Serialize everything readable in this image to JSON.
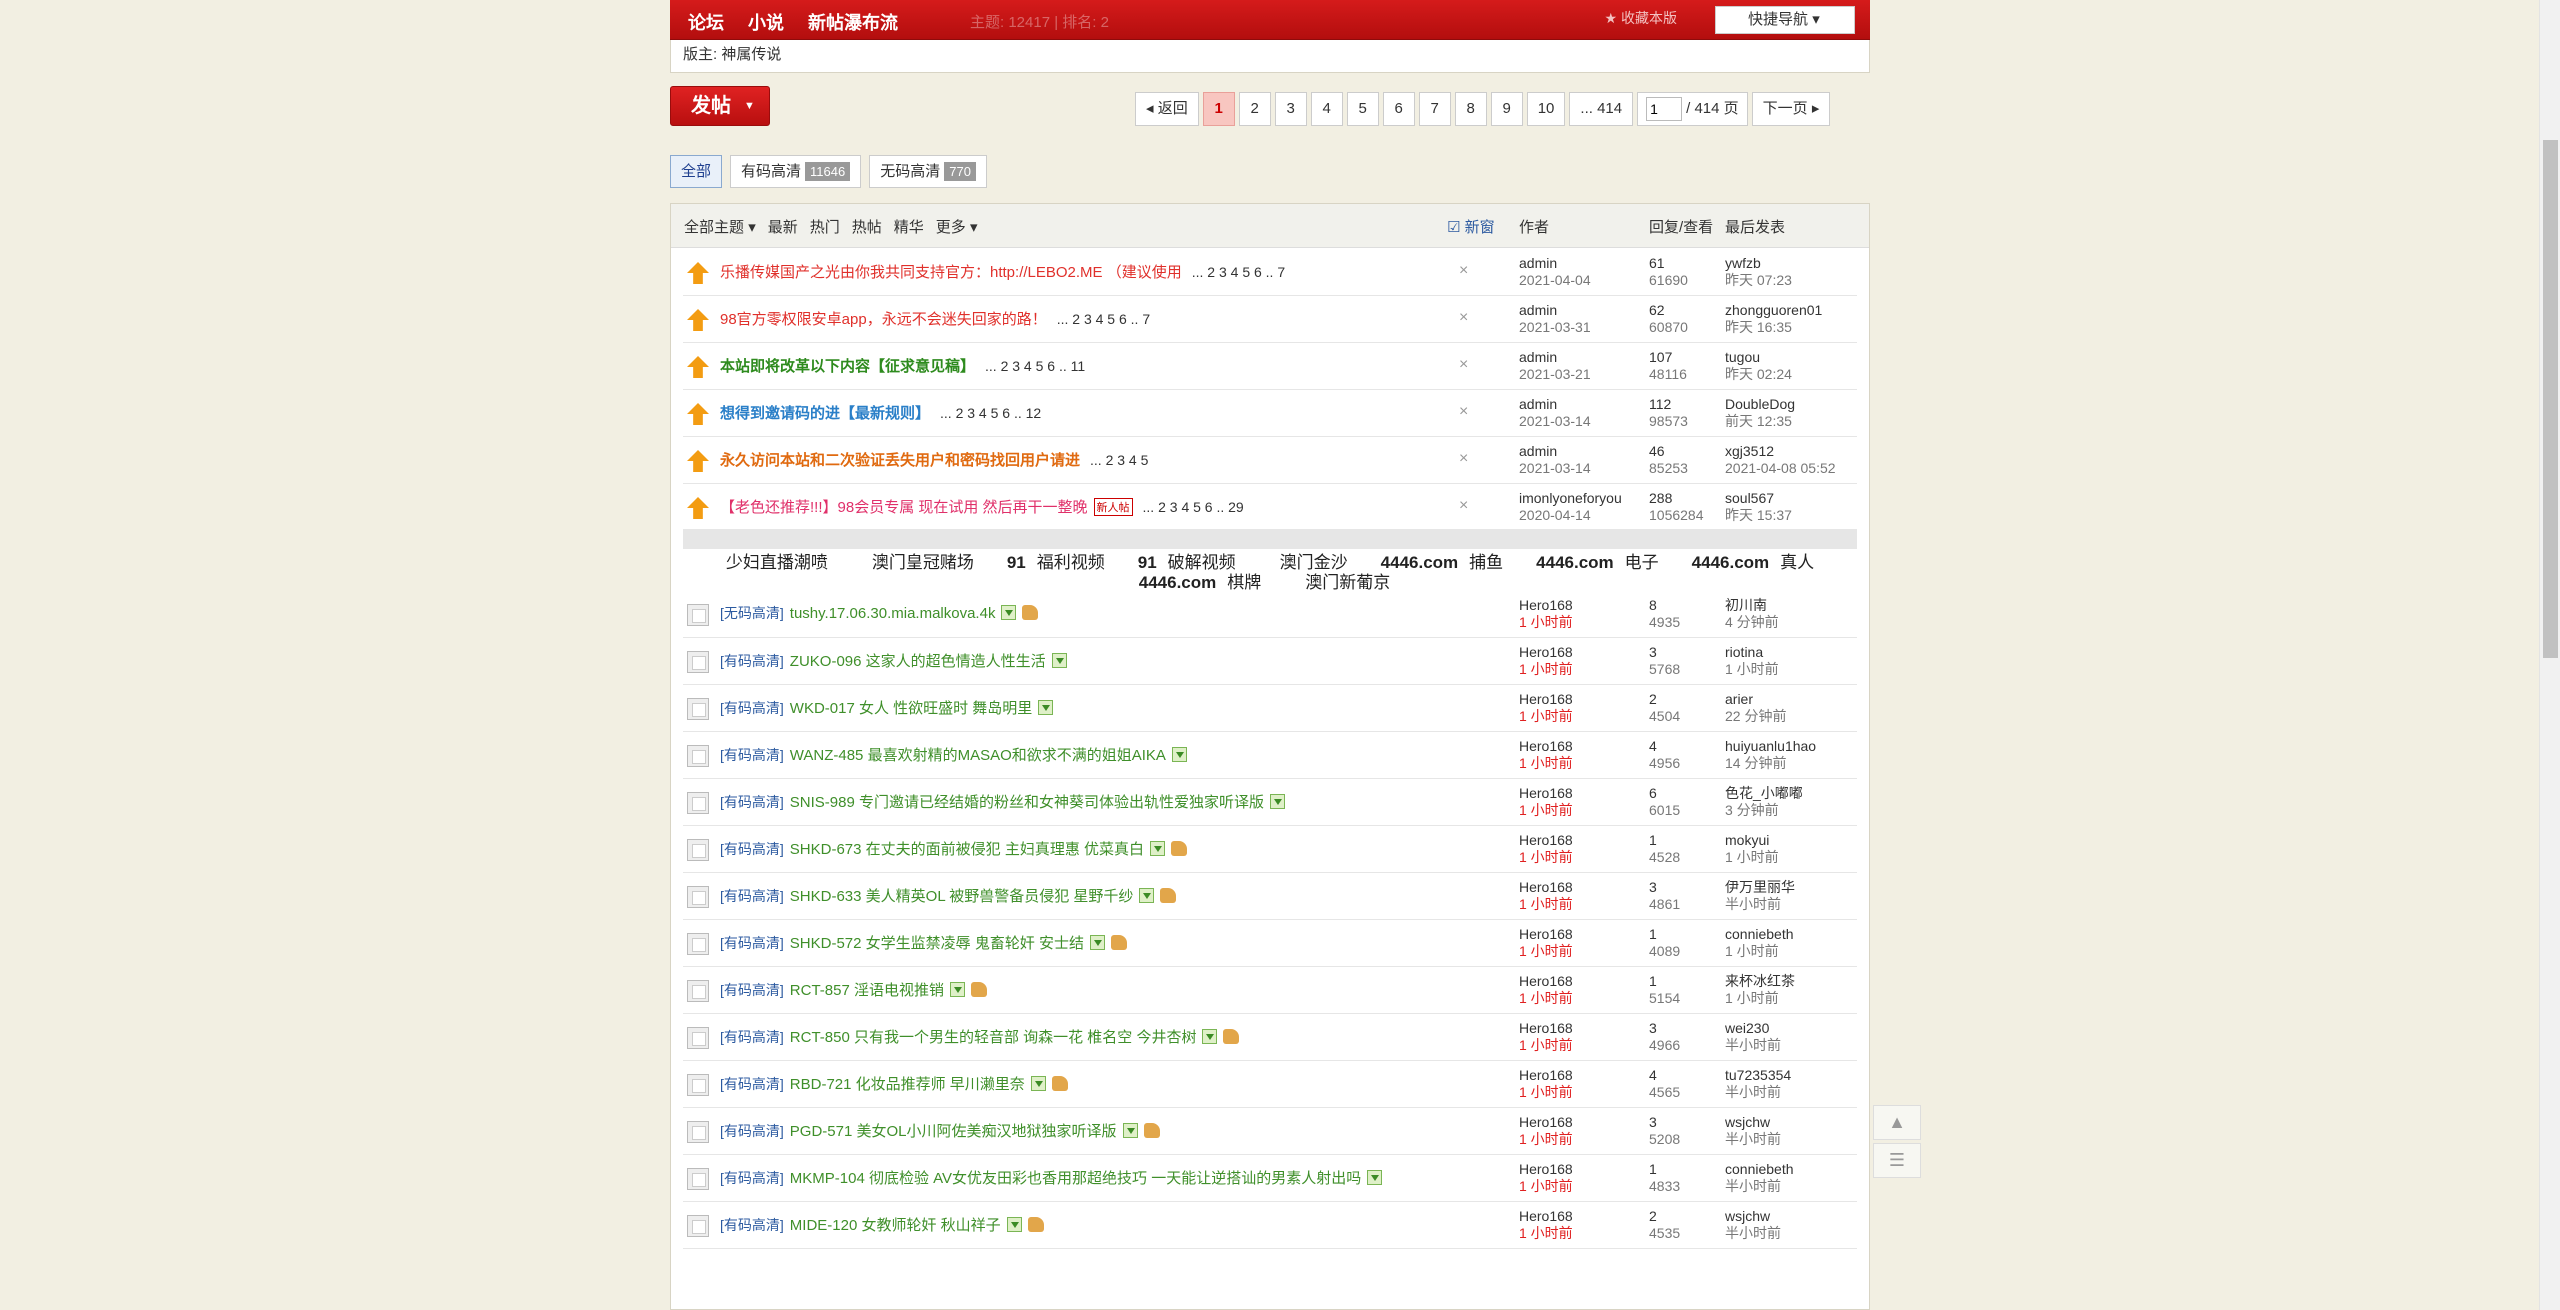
{
  "topbar": {
    "nav": [
      "论坛",
      "小说",
      "新帖瀑布流"
    ],
    "faded_text": "主题: 12417 | 排名: 2",
    "fav_label": "收藏本版",
    "quick_nav": "快捷导航"
  },
  "moderator": "版主: 神属传说",
  "post_button": "发帖",
  "pager": {
    "back": "返回",
    "pages": [
      "1",
      "2",
      "3",
      "4",
      "5",
      "6",
      "7",
      "8",
      "9",
      "10",
      "... 414"
    ],
    "current": "1",
    "input_value": "1",
    "total": "/ 414 页",
    "next": "下一页"
  },
  "filters": [
    {
      "label": "全部",
      "count": ""
    },
    {
      "label": "有码高清",
      "count": "11646"
    },
    {
      "label": "无码高清",
      "count": "770"
    }
  ],
  "table_header": {
    "tabs": [
      "全部主题",
      "最新",
      "热门",
      "热帖",
      "精华",
      "更多"
    ],
    "new_window": "新窗",
    "author": "作者",
    "stats": "回复/查看",
    "last": "最后发表"
  },
  "sticky_threads": [
    {
      "title": "乐播传媒国产之光由你我共同支持官方：http://LEBO2.ME （建议使用",
      "pages": "... 2  3  4  5  6 .. 7",
      "color": "#e0302b",
      "bold": false,
      "author": "admin",
      "date": "2021-04-04",
      "replies": "61",
      "views": "61690",
      "last_user": "ywfzb",
      "last_time": "昨天 07:23"
    },
    {
      "title": "98官方零权限安卓app，永远不会迷失回家的路！",
      "pages": "... 2  3  4  5  6 .. 7",
      "color": "#e0302b",
      "bold": false,
      "author": "admin",
      "date": "2021-03-31",
      "replies": "62",
      "views": "60870",
      "last_user": "zhongguoren01",
      "last_time": "昨天 16:35"
    },
    {
      "title": "本站即将改革以下内容【征求意见稿】",
      "pages": "... 2  3  4  5  6 .. 11",
      "color": "#2e8b1e",
      "bold": true,
      "author": "admin",
      "date": "2021-03-21",
      "replies": "107",
      "views": "48116",
      "last_user": "tugou",
      "last_time": "昨天 02:24"
    },
    {
      "title": "想得到邀请码的进【最新规则】",
      "pages": "... 2  3  4  5  6 .. 12",
      "color": "#2a7fc8",
      "bold": true,
      "author": "admin",
      "date": "2021-03-14",
      "replies": "112",
      "views": "98573",
      "last_user": "DoubleDog",
      "last_time": "前天 12:35"
    },
    {
      "title": "永久访问本站和二次验证丢失用户和密码找回用户请进",
      "pages": "... 2  3  4  5",
      "color": "#e06a10",
      "bold": true,
      "author": "admin",
      "date": "2021-03-14",
      "replies": "46",
      "views": "85253",
      "last_user": "xgj3512",
      "last_time": "2021-04-08 05:52"
    },
    {
      "title": "【老色还推荐!!!】98会员专属 现在试用 然后再干一整晚",
      "pages": "... 2  3  4  5  6 .. 29",
      "color": "#e0306a",
      "bold": false,
      "badge": "新人帖",
      "author": "imonlyoneforyou",
      "date": "2020-04-14",
      "replies": "288",
      "views": "1056284",
      "last_user": "soul567",
      "last_time": "昨天 15:37"
    }
  ],
  "ads": [
    [
      {
        "t": "少妇直播潮喷",
        "b": ""
      },
      {
        "t": "澳门皇冠赌场",
        "b": ""
      },
      {
        "t": "福利视频",
        "b": "91"
      },
      {
        "t": "破解视频",
        "b": "91"
      },
      {
        "t": "澳门金沙",
        "b": ""
      },
      {
        "t": "捕鱼",
        "b": "4446.com"
      },
      {
        "t": "电子",
        "b": "4446.com"
      },
      {
        "t": "真人",
        "b": "4446.com"
      }
    ],
    [
      {
        "t": "棋牌",
        "b": "4446.com"
      },
      {
        "t": "澳门新葡京",
        "b": ""
      }
    ]
  ],
  "threads": [
    {
      "tag": "[无码高清]",
      "title": "tushy.17.06.30.mia.malkova.4k",
      "thumb": true,
      "author": "Hero168",
      "date": "1 小时前",
      "replies": "8",
      "views": "4935",
      "last_user": "初川南",
      "last_time": "4 分钟前"
    },
    {
      "tag": "[有码高清]",
      "title": "ZUKO-096 这家人的超色情造人性生活",
      "thumb": false,
      "author": "Hero168",
      "date": "1 小时前",
      "replies": "3",
      "views": "5768",
      "last_user": "riotina",
      "last_time": "1 小时前"
    },
    {
      "tag": "[有码高清]",
      "title": "WKD-017 女人 性欲旺盛时 舞岛明里",
      "thumb": false,
      "author": "Hero168",
      "date": "1 小时前",
      "replies": "2",
      "views": "4504",
      "last_user": "arier",
      "last_time": "22 分钟前"
    },
    {
      "tag": "[有码高清]",
      "title": "WANZ-485 最喜欢射精的MASAO和欲求不满的姐姐AIKA",
      "thumb": false,
      "author": "Hero168",
      "date": "1 小时前",
      "replies": "4",
      "views": "4956",
      "last_user": "huiyuanlu1hao",
      "last_time": "14 分钟前"
    },
    {
      "tag": "[有码高清]",
      "title": "SNIS-989 专门邀请已经结婚的粉丝和女神葵司体验出轨性爱独家听译版",
      "thumb": false,
      "author": "Hero168",
      "date": "1 小时前",
      "replies": "6",
      "views": "6015",
      "last_user": "色花_小嘟嘟",
      "last_time": "3 分钟前"
    },
    {
      "tag": "[有码高清]",
      "title": "SHKD-673 在丈夫的面前被侵犯 主妇真理惠 优菜真白",
      "thumb": true,
      "author": "Hero168",
      "date": "1 小时前",
      "replies": "1",
      "views": "4528",
      "last_user": "mokyui",
      "last_time": "1 小时前"
    },
    {
      "tag": "[有码高清]",
      "title": "SHKD-633 美人精英OL 被野兽警备员侵犯 星野千纱",
      "thumb": true,
      "author": "Hero168",
      "date": "1 小时前",
      "replies": "3",
      "views": "4861",
      "last_user": "伊万里丽华",
      "last_time": "半小时前"
    },
    {
      "tag": "[有码高清]",
      "title": "SHKD-572 女学生监禁凌辱 鬼畜轮奸 安士结",
      "thumb": true,
      "author": "Hero168",
      "date": "1 小时前",
      "replies": "1",
      "views": "4089",
      "last_user": "conniebeth",
      "last_time": "1 小时前"
    },
    {
      "tag": "[有码高清]",
      "title": "RCT-857 淫语电视推销",
      "thumb": true,
      "author": "Hero168",
      "date": "1 小时前",
      "replies": "1",
      "views": "5154",
      "last_user": "来杯冰红茶",
      "last_time": "1 小时前"
    },
    {
      "tag": "[有码高清]",
      "title": "RCT-850 只有我一个男生的轻音部 询森一花 椎名空 今井杏树",
      "thumb": true,
      "author": "Hero168",
      "date": "1 小时前",
      "replies": "3",
      "views": "4966",
      "last_user": "wei230",
      "last_time": "半小时前"
    },
    {
      "tag": "[有码高清]",
      "title": "RBD-721 化妆品推荐师 早川濑里奈",
      "thumb": true,
      "author": "Hero168",
      "date": "1 小时前",
      "replies": "4",
      "views": "4565",
      "last_user": "tu7235354",
      "last_time": "半小时前"
    },
    {
      "tag": "[有码高清]",
      "title": "PGD-571 美女OL小川阿佐美痴汉地狱独家听译版",
      "thumb": true,
      "author": "Hero168",
      "date": "1 小时前",
      "replies": "3",
      "views": "5208",
      "last_user": "wsjchw",
      "last_time": "半小时前"
    },
    {
      "tag": "[有码高清]",
      "title": "MKMP-104 彻底检验 AV女优友田彩也香用那超绝技巧 一天能让逆搭讪的男素人射出吗",
      "thumb": false,
      "author": "Hero168",
      "date": "1 小时前",
      "replies": "1",
      "views": "4833",
      "last_user": "conniebeth",
      "last_time": "半小时前"
    },
    {
      "tag": "[有码高清]",
      "title": "MIDE-120 女教师轮奸 秋山祥子",
      "thumb": true,
      "author": "Hero168",
      "date": "1 小时前",
      "replies": "2",
      "views": "4535",
      "last_user": "wsjchw",
      "last_time": "半小时前"
    }
  ],
  "float_tools": [
    "▲",
    "☰"
  ]
}
